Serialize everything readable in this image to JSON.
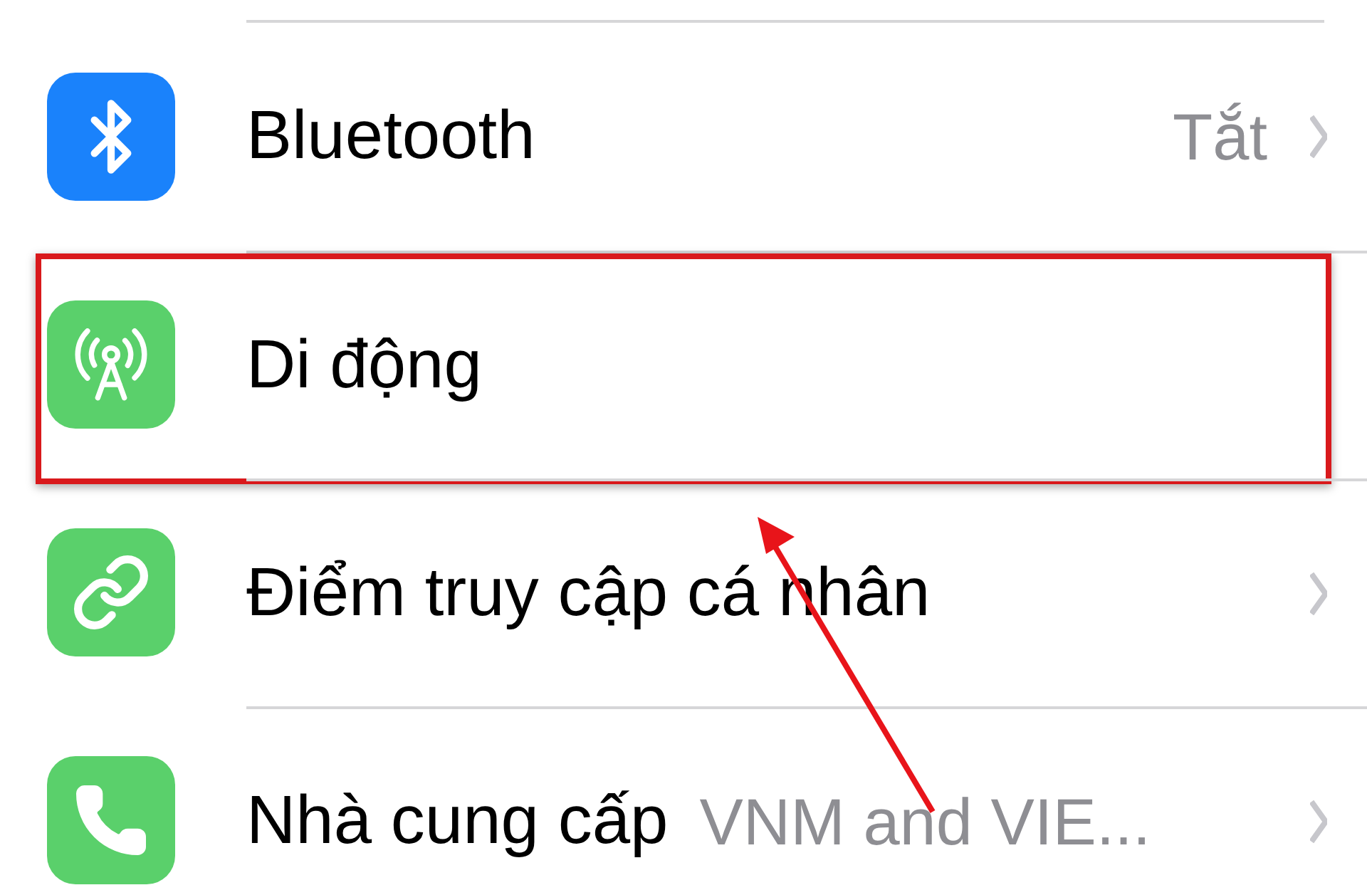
{
  "settings_rows": [
    {
      "kind": "bluetooth",
      "label": "Bluetooth",
      "status": "Tắt",
      "color": "#1a82fb",
      "chevron": true,
      "highlighted": false
    },
    {
      "kind": "cellular",
      "label": "Di động",
      "color": "#5ad06b",
      "chevron": false,
      "highlighted": true
    },
    {
      "kind": "hotspot",
      "label": "Điểm truy cập cá nhân",
      "color": "#5ad06b",
      "chevron": true,
      "highlighted": false
    },
    {
      "kind": "carrier",
      "label": "Nhà cung cấp",
      "value": "VNM and VIE...",
      "color": "#5ad06b",
      "chevron": true,
      "highlighted": false
    }
  ],
  "annotation": {
    "arrow": true
  }
}
